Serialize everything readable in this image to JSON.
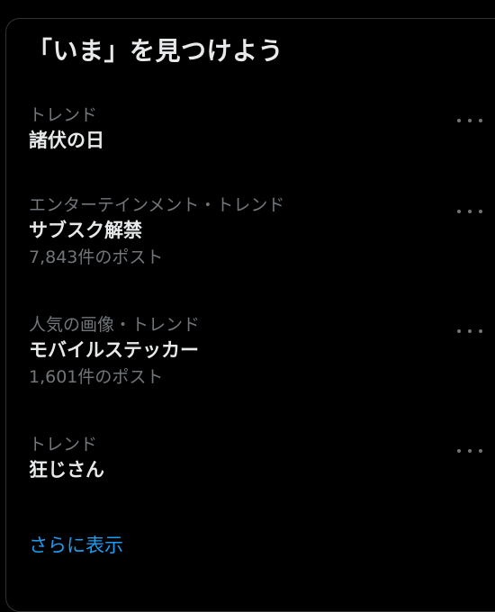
{
  "panel": {
    "title": "「いま」を見つけよう",
    "show_more_label": "さらに表示"
  },
  "trends": [
    {
      "category": "トレンド",
      "name": "諸伏の日",
      "count": ""
    },
    {
      "category": "エンターテインメント・トレンド",
      "name": "サブスク解禁",
      "count": "7,843件のポスト"
    },
    {
      "category": "人気の画像・トレンド",
      "name": "モバイルステッカー",
      "count": "1,601件のポスト"
    },
    {
      "category": "トレンド",
      "name": "狂じさん",
      "count": ""
    }
  ],
  "icons": {
    "more": "more-horizontal-icon"
  },
  "colors": {
    "background": "#000000",
    "primary_text": "#e7e9ea",
    "secondary_text": "#71767b",
    "accent": "#1d9bf0",
    "border": "#2f3336"
  }
}
